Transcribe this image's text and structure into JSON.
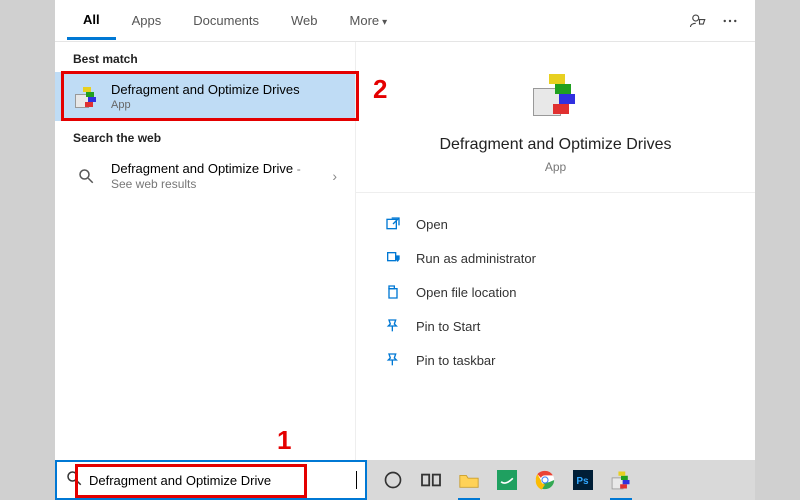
{
  "tabs": {
    "all": "All",
    "apps": "Apps",
    "documents": "Documents",
    "web": "Web",
    "more": "More"
  },
  "sections": {
    "best_match": "Best match",
    "search_web": "Search the web"
  },
  "best_match": {
    "title": "Defragment and Optimize Drives",
    "sub": "App"
  },
  "web_result": {
    "title": "Defragment and Optimize Drive",
    "sub": "See web results"
  },
  "preview": {
    "title": "Defragment and Optimize Drives",
    "sub": "App",
    "actions": {
      "open": "Open",
      "admin": "Run as administrator",
      "loc": "Open file location",
      "pin_start": "Pin to Start",
      "pin_taskbar": "Pin to taskbar"
    }
  },
  "search": {
    "value": "Defragment and Optimize Drive"
  },
  "annotations": {
    "a1": "1",
    "a2": "2"
  },
  "colors": {
    "accent": "#0078d4",
    "annotation": "#e40000"
  }
}
